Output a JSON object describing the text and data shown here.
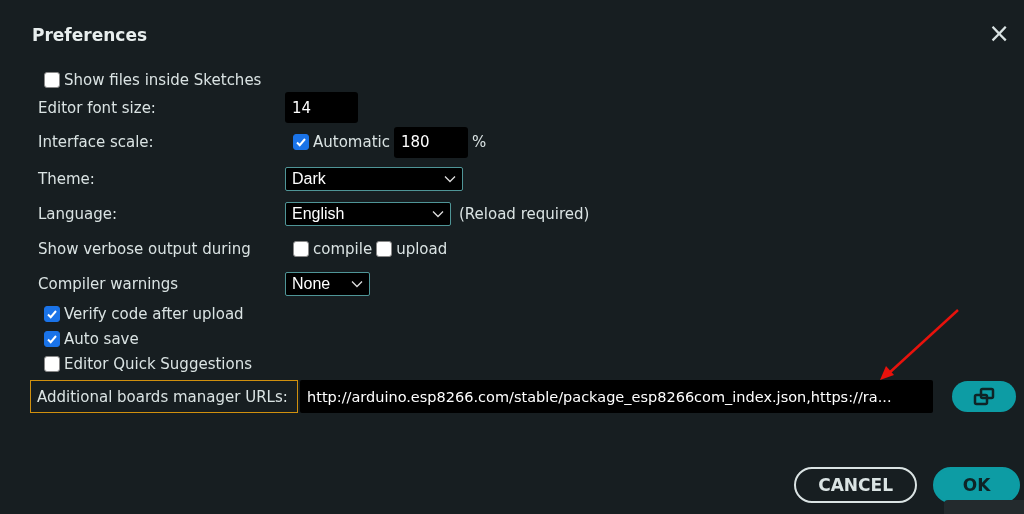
{
  "dialog": {
    "title": "Preferences",
    "close": "×"
  },
  "settings": [
    {
      "kind": "checkbox",
      "label": "Show files inside Sketches",
      "checked": false
    },
    {
      "kind": "input",
      "label": "Editor font size:",
      "value": "14"
    },
    {
      "kind": "scale",
      "label": "Interface scale:",
      "option": "Automatic",
      "checked": true,
      "value": "180",
      "unit": "%"
    },
    {
      "kind": "select",
      "label": "Theme:",
      "value": "Dark"
    },
    {
      "kind": "select",
      "label": "Language:",
      "value": "English",
      "note": "(Reload required)"
    },
    {
      "kind": "options",
      "label": "Show verbose output during",
      "options": [
        {
          "label": "compile",
          "checked": false
        },
        {
          "label": "upload",
          "checked": false
        }
      ]
    },
    {
      "kind": "select",
      "label": "Compiler warnings",
      "value": "None"
    },
    {
      "kind": "checkbox",
      "label": "Verify code after upload",
      "checked": true
    },
    {
      "kind": "checkbox",
      "label": "Auto save",
      "checked": true
    },
    {
      "kind": "checkbox",
      "label": "Editor Quick Suggestions",
      "checked": false
    }
  ],
  "boards_urls": {
    "label": "Additional boards manager URLs:",
    "value": "http://arduino.esp8266.com/stable/package_esp8266com_index.json,https://ra..."
  },
  "buttons": [
    {
      "label": "CANCEL",
      "primary": false
    },
    {
      "label": "OK",
      "primary": true
    }
  ]
}
